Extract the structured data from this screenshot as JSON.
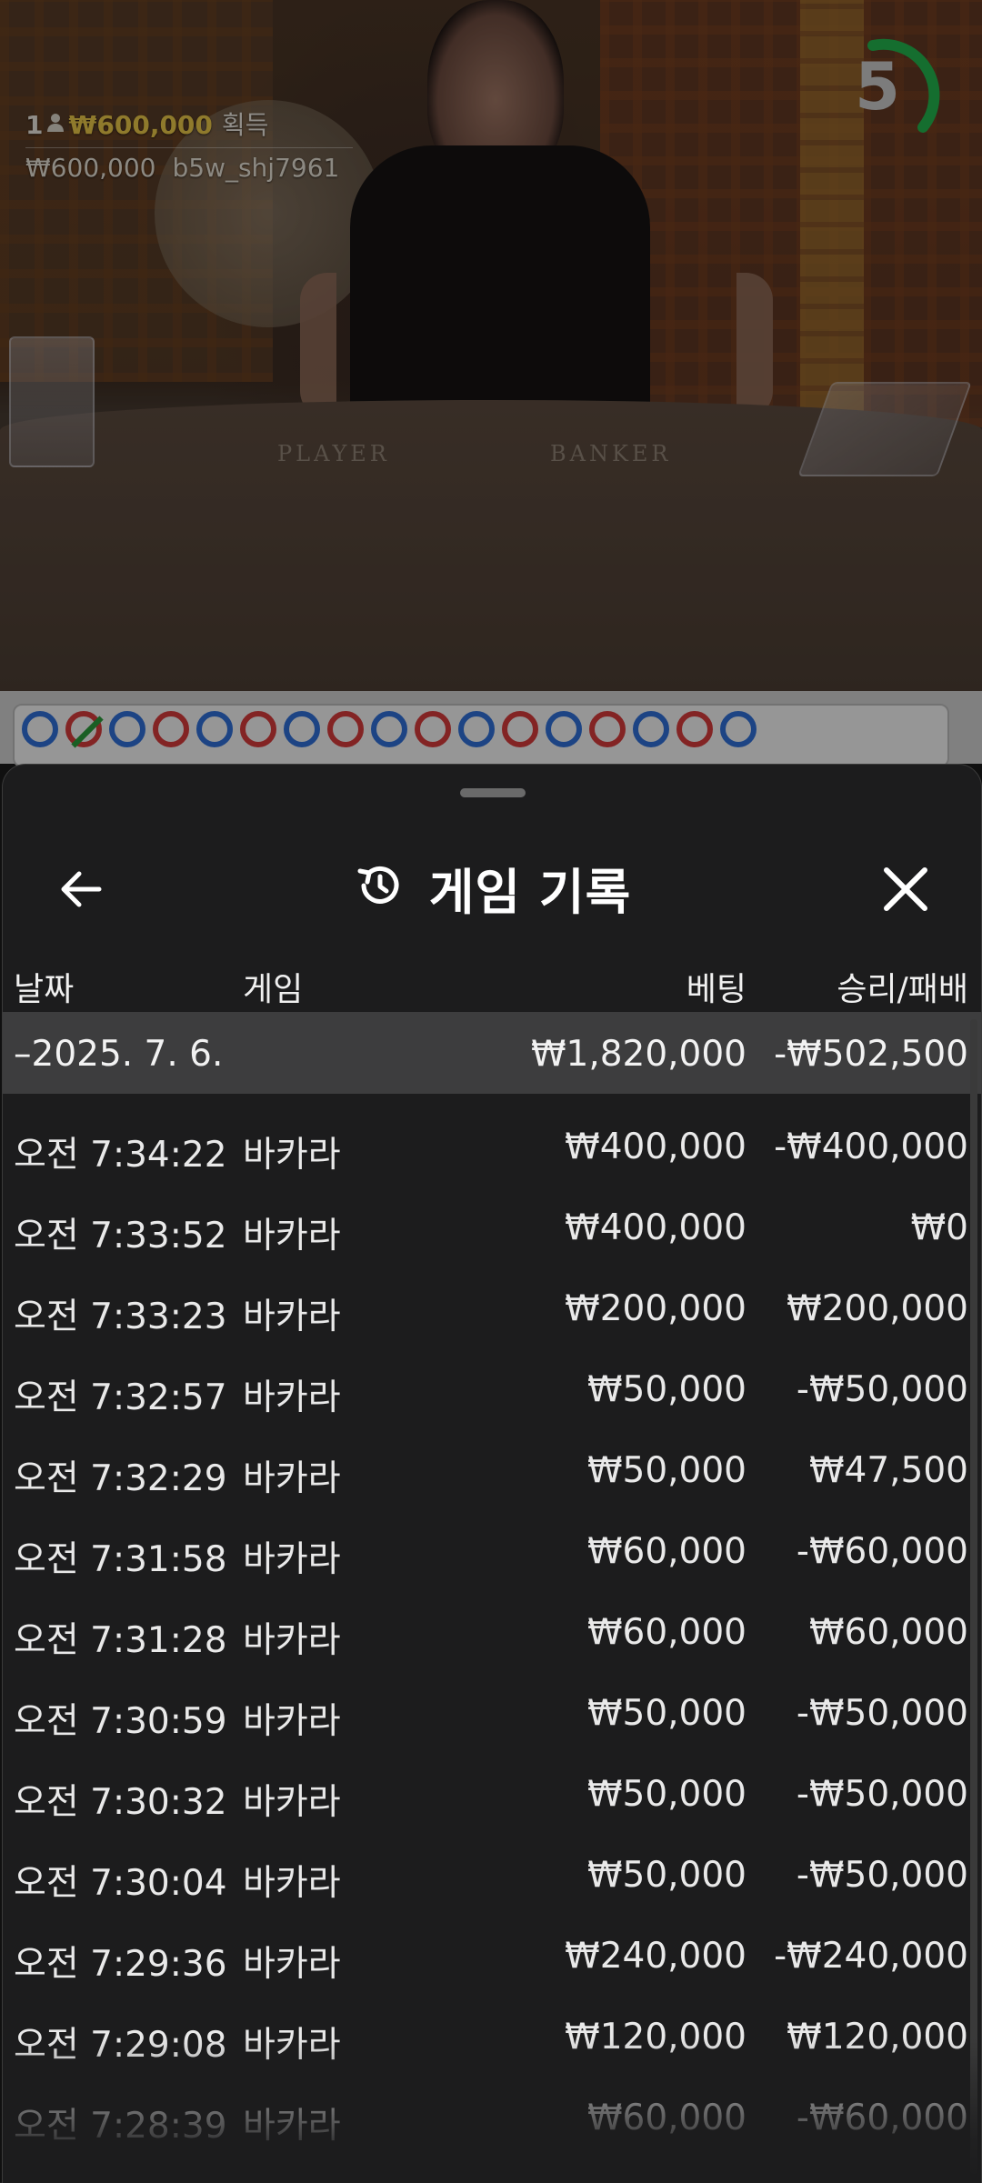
{
  "video": {
    "winner_count": "1",
    "winner_amount": "₩600,000",
    "winner_label": "획득",
    "winner_detail_amount": "₩600,000",
    "winner_username": "b5w_shj7961",
    "timer_value": "5",
    "table_left_label": "PLAYER",
    "table_right_label": "BANKER",
    "timer_color": "#22b24c",
    "winner_color": "#e7c547"
  },
  "roadmap": {
    "beads": [
      "blue",
      "red-slash",
      "blue",
      "red",
      "blue",
      "red",
      "blue",
      "red",
      "blue",
      "red",
      "blue",
      "red",
      "blue",
      "red",
      "blue",
      "red",
      "blue"
    ]
  },
  "sheet": {
    "title": "게임 기록",
    "back_icon": "arrow-left-icon",
    "history_icon": "history-icon",
    "close_icon": "close-icon",
    "columns": {
      "date": "날짜",
      "game": "게임",
      "bet": "베팅",
      "result": "승리/패배"
    },
    "date_group": {
      "date": "–2025. 7. 6.",
      "bet_total": "₩1,820,000",
      "result_total": "-₩502,500"
    },
    "rows": [
      {
        "time": "오전 7:34:22",
        "game": "바카라",
        "bet": "₩400,000",
        "result": "-₩400,000"
      },
      {
        "time": "오전 7:33:52",
        "game": "바카라",
        "bet": "₩400,000",
        "result": "₩0"
      },
      {
        "time": "오전 7:33:23",
        "game": "바카라",
        "bet": "₩200,000",
        "result": "₩200,000"
      },
      {
        "time": "오전 7:32:57",
        "game": "바카라",
        "bet": "₩50,000",
        "result": "-₩50,000"
      },
      {
        "time": "오전 7:32:29",
        "game": "바카라",
        "bet": "₩50,000",
        "result": "₩47,500"
      },
      {
        "time": "오전 7:31:58",
        "game": "바카라",
        "bet": "₩60,000",
        "result": "-₩60,000"
      },
      {
        "time": "오전 7:31:28",
        "game": "바카라",
        "bet": "₩60,000",
        "result": "₩60,000"
      },
      {
        "time": "오전 7:30:59",
        "game": "바카라",
        "bet": "₩50,000",
        "result": "-₩50,000"
      },
      {
        "time": "오전 7:30:32",
        "game": "바카라",
        "bet": "₩50,000",
        "result": "-₩50,000"
      },
      {
        "time": "오전 7:30:04",
        "game": "바카라",
        "bet": "₩50,000",
        "result": "-₩50,000"
      },
      {
        "time": "오전 7:29:36",
        "game": "바카라",
        "bet": "₩240,000",
        "result": "-₩240,000"
      },
      {
        "time": "오전 7:29:08",
        "game": "바카라",
        "bet": "₩120,000",
        "result": "₩120,000"
      },
      {
        "time": "오전 7:28:39",
        "game": "바카라",
        "bet": "₩60,000",
        "result": "-₩60,000"
      }
    ]
  }
}
